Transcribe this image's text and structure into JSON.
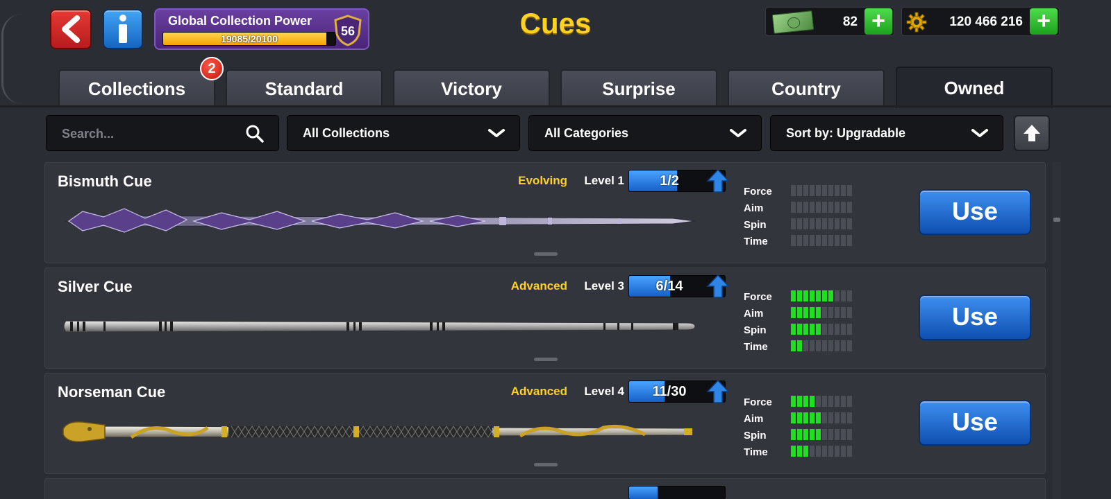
{
  "header": {
    "title": "Cues",
    "global_power": {
      "label": "Global Collection Power",
      "progress_text": "19085/20100",
      "progress": 0.9495,
      "level": "56"
    },
    "cash": {
      "value": "82",
      "icon": "cash-icon"
    },
    "coins": {
      "value": "120 466 216",
      "icon": "coins-gear-icon"
    }
  },
  "tabs": [
    {
      "label": "Collections",
      "badge": "2"
    },
    {
      "label": "Standard"
    },
    {
      "label": "Victory"
    },
    {
      "label": "Surprise"
    },
    {
      "label": "Country"
    },
    {
      "label": "Owned",
      "active": true
    }
  ],
  "filters": {
    "search_placeholder": "Search...",
    "collection": "All Collections",
    "category": "All Categories",
    "sort": "Sort by: Upgradable"
  },
  "stat_labels": {
    "force": "Force",
    "aim": "Aim",
    "spin": "Spin",
    "time": "Time"
  },
  "cues": [
    {
      "name": "Bismuth Cue",
      "tier": "Evolving",
      "level": "Level 1",
      "progress_text": "1/2",
      "progress": 0.5,
      "stats": {
        "force": 0,
        "aim": 0,
        "spin": 0,
        "time": 0
      },
      "use_label": "Use"
    },
    {
      "name": "Silver Cue",
      "tier": "Advanced",
      "level": "Level 3",
      "progress_text": "6/14",
      "progress": 0.43,
      "stats": {
        "force": 7,
        "aim": 5,
        "spin": 5,
        "time": 2
      },
      "use_label": "Use"
    },
    {
      "name": "Norseman Cue",
      "tier": "Advanced",
      "level": "Level 4",
      "progress_text": "11/30",
      "progress": 0.37,
      "stats": {
        "force": 4,
        "aim": 5,
        "spin": 5,
        "time": 3
      },
      "use_label": "Use"
    }
  ],
  "stat_max": 10,
  "colors": {
    "accent_yellow": "#ffd21f",
    "use_blue": "#1f6fd6",
    "stat_green": "#1ee01e",
    "back_red": "#d32f2f",
    "info_blue": "#1e88e5"
  }
}
